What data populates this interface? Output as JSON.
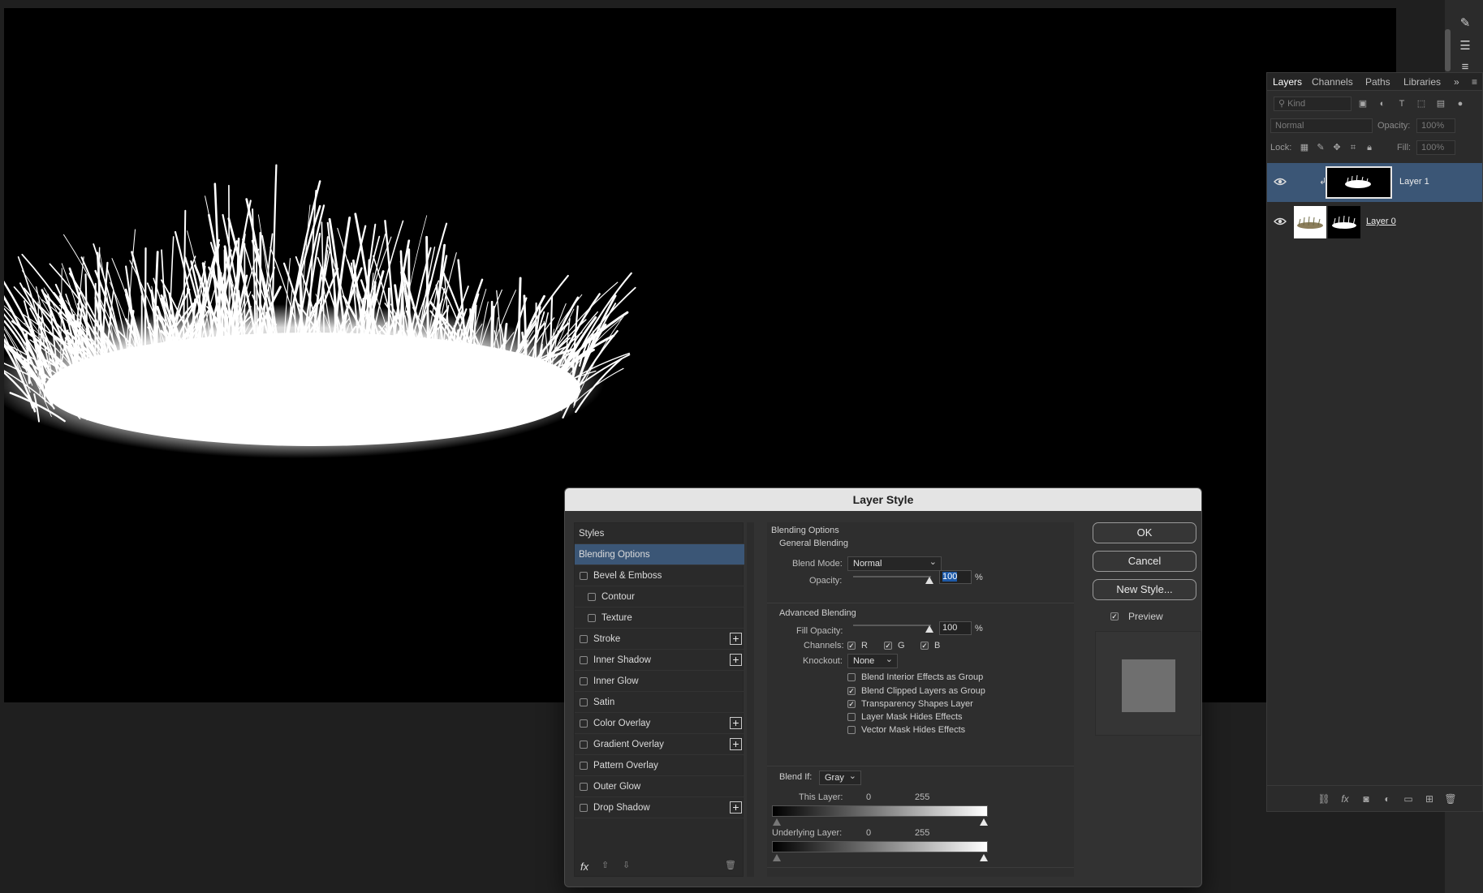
{
  "layers_panel": {
    "tabs": [
      "Layers",
      "Channels",
      "Paths",
      "Libraries"
    ],
    "filter_placeholder": "Kind",
    "blend_mode": "Normal",
    "opacity_label": "Opacity:",
    "opacity_value": "100%",
    "lock_label": "Lock:",
    "fill_label": "Fill:",
    "fill_value": "100%",
    "layers": [
      {
        "name": "Layer 1",
        "selected": true
      },
      {
        "name": "Layer 0",
        "selected": false
      }
    ]
  },
  "dialog": {
    "title": "Layer Style",
    "styles_header": "Styles",
    "styles": [
      {
        "label": "Blending Options",
        "selected": true
      },
      {
        "label": "Bevel & Emboss"
      },
      {
        "label": "Contour"
      },
      {
        "label": "Texture"
      },
      {
        "label": "Stroke"
      },
      {
        "label": "Inner Shadow"
      },
      {
        "label": "Inner Glow"
      },
      {
        "label": "Satin"
      },
      {
        "label": "Color Overlay"
      },
      {
        "label": "Gradient Overlay"
      },
      {
        "label": "Pattern Overlay"
      },
      {
        "label": "Outer Glow"
      },
      {
        "label": "Drop Shadow"
      }
    ],
    "blending": {
      "title": "Blending Options",
      "general_title": "General Blending",
      "blend_mode_label": "Blend Mode:",
      "blend_mode_value": "Normal",
      "opacity_label": "Opacity:",
      "opacity_value": "100",
      "percent": "%",
      "advanced_title": "Advanced Blending",
      "fill_opacity_label": "Fill Opacity:",
      "fill_opacity_value": "100",
      "channels_label": "Channels:",
      "channel_r": "R",
      "channel_g": "G",
      "channel_b": "B",
      "knockout_label": "Knockout:",
      "knockout_value": "None",
      "options": [
        {
          "label": "Blend Interior Effects as Group",
          "checked": false
        },
        {
          "label": "Blend Clipped Layers as Group",
          "checked": true
        },
        {
          "label": "Transparency Shapes Layer",
          "checked": true
        },
        {
          "label": "Layer Mask Hides Effects",
          "checked": false
        },
        {
          "label": "Vector Mask Hides Effects",
          "checked": false
        }
      ],
      "blend_if_label": "Blend If:",
      "blend_if_value": "Gray",
      "this_layer_label": "This Layer:",
      "this_layer_min": "0",
      "this_layer_max": "255",
      "underlying_label": "Underlying Layer:",
      "underlying_min": "0",
      "underlying_max": "255"
    },
    "buttons": {
      "ok": "OK",
      "cancel": "Cancel",
      "new_style": "New Style..."
    },
    "preview_label": "Preview",
    "footer_fx": "fx"
  },
  "colors": {
    "selection": "#3b5676",
    "canvas": "#000000"
  }
}
